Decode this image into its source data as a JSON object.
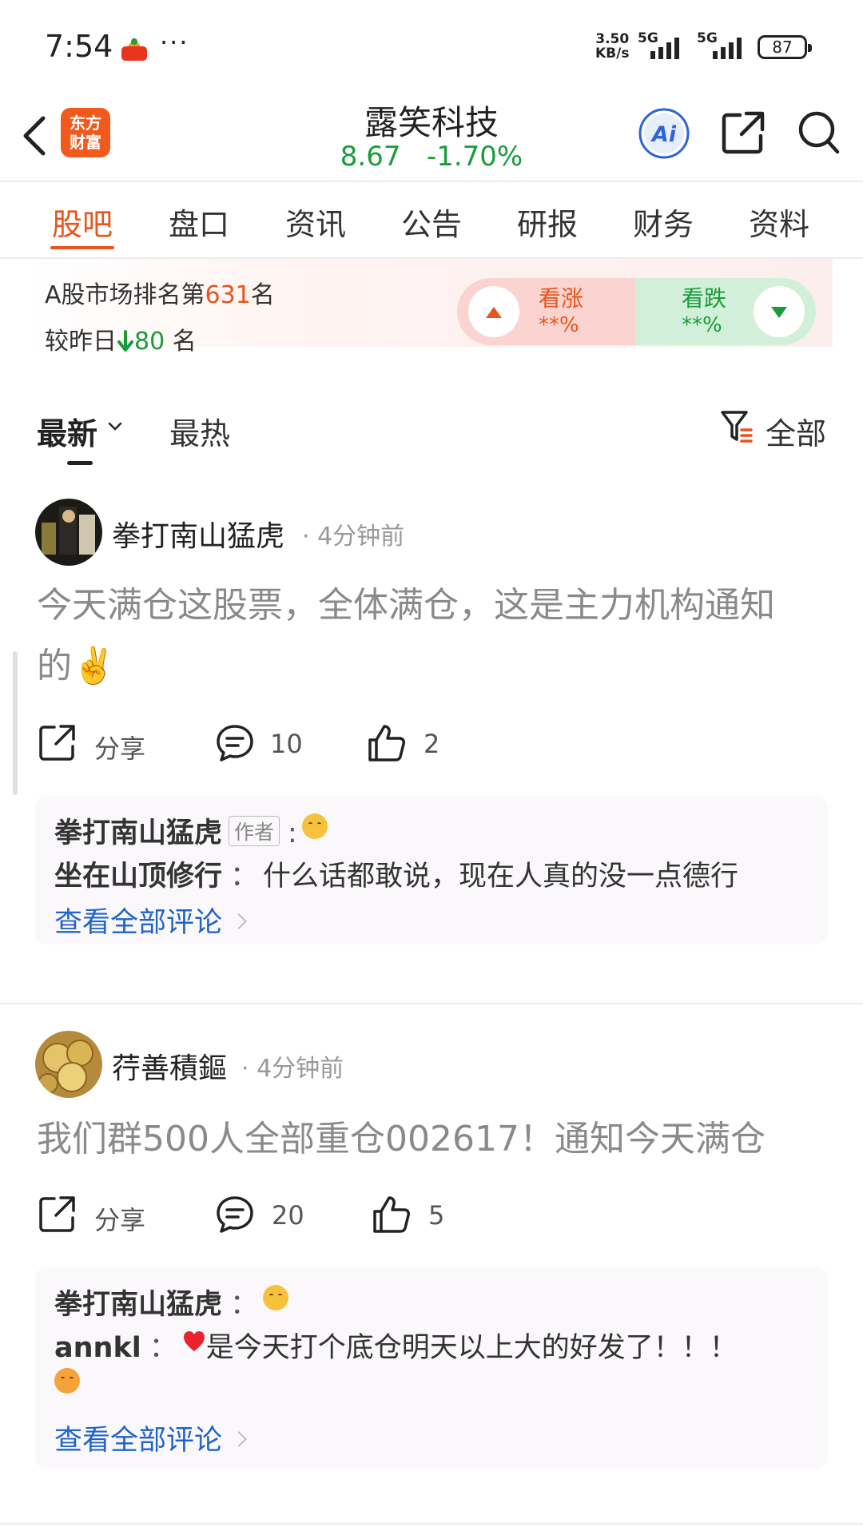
{
  "status_bar": {
    "time": "7:54",
    "dots": "···",
    "net_speed_top": "3.50",
    "net_speed_bottom": "KB/s",
    "sim1": "5G",
    "sim2": "5G",
    "battery": "87"
  },
  "header": {
    "logo_line1": "东方",
    "logo_line2": "财富",
    "stock_name": "露笑科技",
    "price": "8.67",
    "change": "-1.70%"
  },
  "tabs": [
    "股吧",
    "盘口",
    "资讯",
    "公告",
    "研报",
    "财务",
    "资料"
  ],
  "rank": {
    "prefix": "A股市场排名第",
    "value": "631",
    "suffix": "名",
    "compare_prefix": "较昨日",
    "compare_value": "80",
    "compare_suffix": " 名",
    "up_label": "看涨",
    "up_pct": "**%",
    "down_label": "看跌",
    "down_pct": "**%"
  },
  "sort": {
    "latest": "最新",
    "hot": "最热",
    "filter": "全部"
  },
  "posts": [
    {
      "author": "拳打南山猛虎",
      "time": "· 4分钟前",
      "body_line1": "今天满仓这股票，全体满仓，这是主力机构通知",
      "body_line2": "的✌️",
      "share": "分享",
      "comments": "10",
      "likes": "2",
      "replies": [
        {
          "name": "拳打南山猛虎",
          "tag": "作者",
          "sep": ":",
          "text": ""
        },
        {
          "name": "坐在山顶修行",
          "sep": "：",
          "text": "什么话都敢说，现在人真的没一点德行"
        }
      ],
      "view_all": "查看全部评论"
    },
    {
      "author": "荇善積鏂",
      "time": "· 4分钟前",
      "body_line1": "我们群500人全部重仓002617！通知今天满仓",
      "share": "分享",
      "comments": "20",
      "likes": "5",
      "replies": [
        {
          "name": "拳打南山猛虎",
          "sep": "：",
          "text": ""
        },
        {
          "name": "annkl",
          "sep": "：",
          "text": "是今天打个底仓明天以上大的好发了！！！"
        }
      ],
      "view_all": "查看全部评论"
    }
  ],
  "colors": {
    "accent": "#e8541a",
    "down_green": "#1a9c3a",
    "link_blue": "#2164c7",
    "ai_blue": "#2b63d9"
  }
}
